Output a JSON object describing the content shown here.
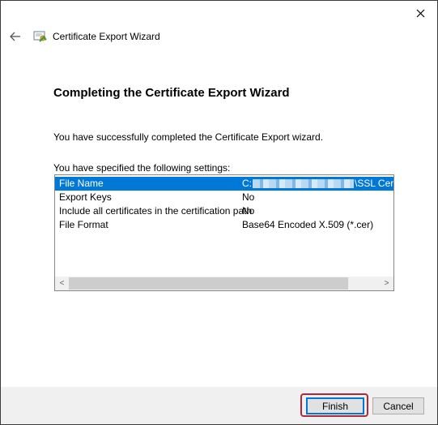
{
  "window": {
    "close_glyph": "✕",
    "close_icon": "close-icon"
  },
  "header": {
    "back_glyph": "←",
    "back_icon": "arrow-left-icon",
    "wizard_icon": "certificate-icon",
    "title": "Certificate Export Wizard"
  },
  "main": {
    "heading": "Completing the Certificate Export Wizard",
    "success_text": "You have successfully completed the Certificate Export wizard.",
    "settings_label": "You have specified the following settings:",
    "settings": [
      {
        "name": "File Name",
        "value_prefix": "C:",
        "value_suffix": "\\SSL Certif",
        "selected": true
      },
      {
        "name": "Export Keys",
        "value": "No"
      },
      {
        "name": "Include all certificates in the certification path",
        "value": "No"
      },
      {
        "name": "File Format",
        "value": "Base64 Encoded X.509 (*.cer)"
      }
    ],
    "scroll_left_glyph": "<",
    "scroll_right_glyph": ">"
  },
  "footer": {
    "finish_label": "Finish",
    "cancel_label": "Cancel"
  },
  "colors": {
    "selection": "#0078d7",
    "highlight_box": "#b0283a"
  }
}
